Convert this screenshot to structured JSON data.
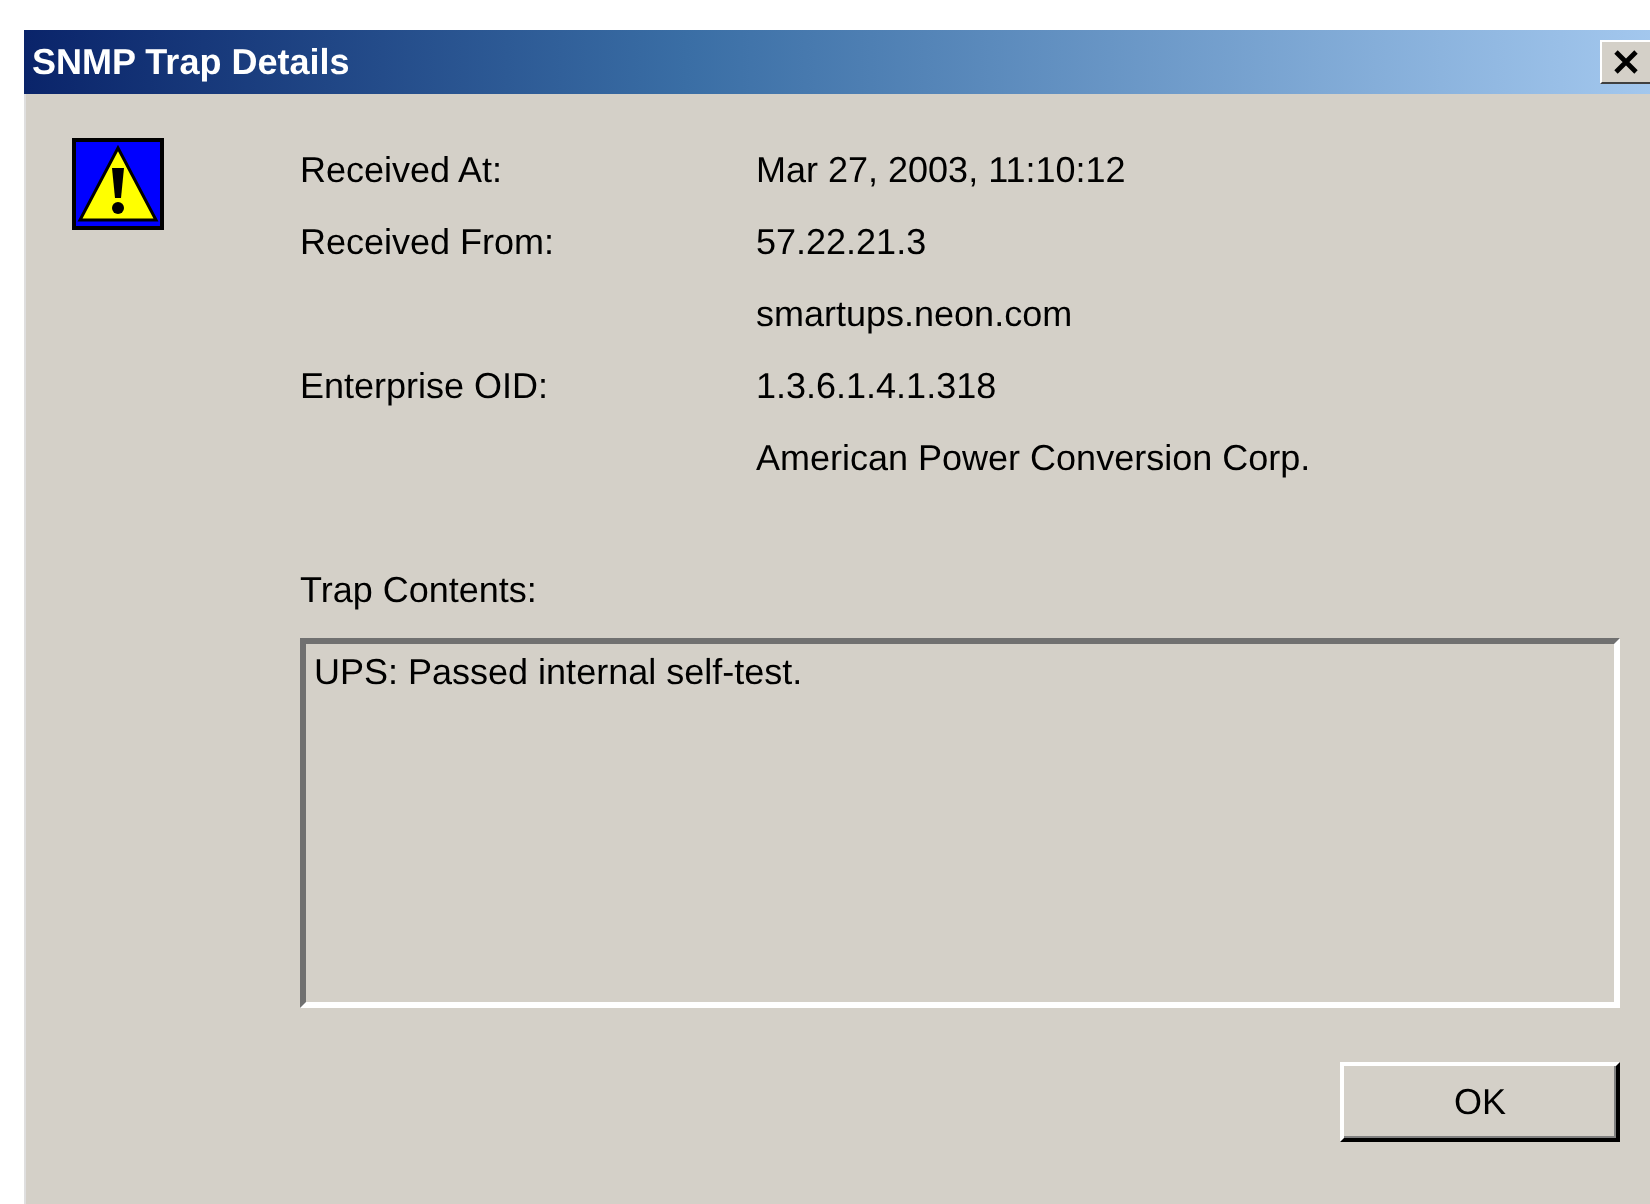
{
  "window": {
    "title": "SNMP Trap Details"
  },
  "fields": [
    {
      "label": "Received At:",
      "values": [
        "Mar 27, 2003, 11:10:12"
      ]
    },
    {
      "label": "Received From:",
      "values": [
        "57.22.21.3",
        "smartups.neon.com"
      ]
    },
    {
      "label": "Enterprise OID:",
      "values": [
        "1.3.6.1.4.1.318",
        "American Power Conversion Corp."
      ]
    }
  ],
  "trap_contents": {
    "label": "Trap Contents:",
    "value": "UPS: Passed internal self-test."
  },
  "buttons": [
    "OK"
  ]
}
